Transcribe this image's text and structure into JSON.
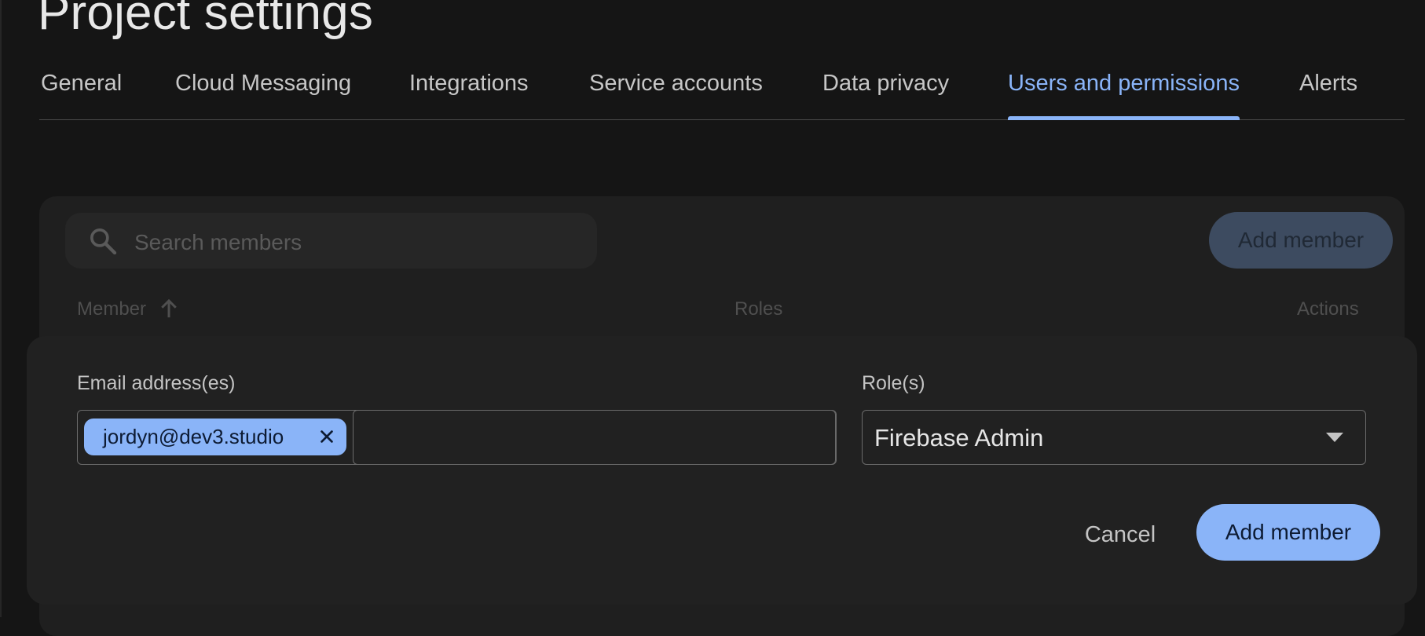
{
  "header": {
    "title": "Project settings"
  },
  "tabs": [
    {
      "label": "General",
      "active": false
    },
    {
      "label": "Cloud Messaging",
      "active": false
    },
    {
      "label": "Integrations",
      "active": false
    },
    {
      "label": "Service accounts",
      "active": false
    },
    {
      "label": "Data privacy",
      "active": false
    },
    {
      "label": "Users and permissions",
      "active": true
    },
    {
      "label": "Alerts",
      "active": false
    }
  ],
  "members_panel": {
    "search": {
      "placeholder": "Search members",
      "icon": "search-icon"
    },
    "add_button_label": "Add member",
    "columns": {
      "member": "Member",
      "member_sort_icon": "arrow-up-icon",
      "roles": "Roles",
      "actions": "Actions"
    }
  },
  "add_member_dialog": {
    "email_label": "Email address(es)",
    "email_chips": [
      {
        "label": "jordyn@dev3.studio",
        "remove_icon": "close-icon"
      }
    ],
    "email_input_value": "",
    "role_label": "Role(s)",
    "role_value": "Firebase Admin",
    "role_dropdown_icon": "caret-down-icon",
    "cancel_label": "Cancel",
    "submit_label": "Add member"
  },
  "colors": {
    "accent": "#8ab4f8",
    "background": "#151515",
    "surface": "#212121",
    "text_primary": "#e3e3e3",
    "text_secondary": "#c4c4c4"
  }
}
